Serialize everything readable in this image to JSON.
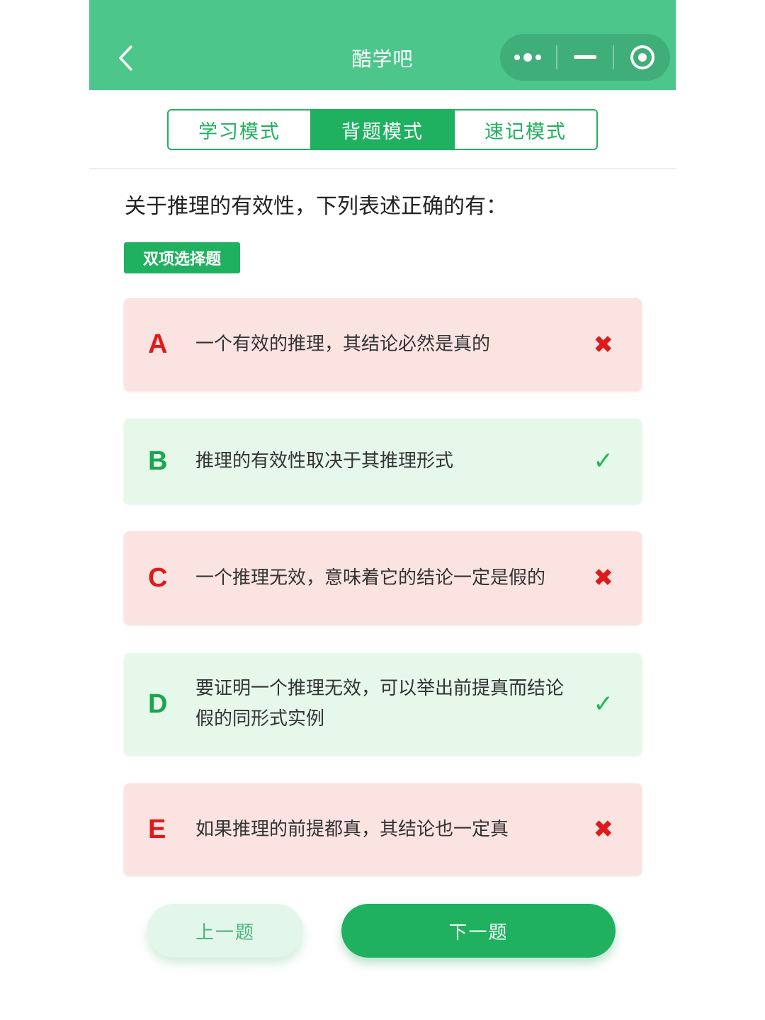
{
  "header": {
    "title": "酷学吧",
    "background_color": "#4cc68b",
    "back_icon": "chevron-left-icon",
    "capsule_icons": [
      "more-dots-icon",
      "minimize-icon",
      "record-target-icon"
    ]
  },
  "tabs": [
    {
      "label": "学习模式",
      "active": false
    },
    {
      "label": "背题模式",
      "active": true
    },
    {
      "label": "速记模式",
      "active": false
    }
  ],
  "question": {
    "text": "关于推理的有效性，下列表述正确的有：",
    "type_badge": "双项选择题"
  },
  "options": [
    {
      "letter": "A",
      "text": "一个有效的推理，其结论必然是真的",
      "status": "wrong",
      "mark": "✖"
    },
    {
      "letter": "B",
      "text": "推理的有效性取决于其推理形式",
      "status": "right",
      "mark": "✓"
    },
    {
      "letter": "C",
      "text": "一个推理无效，意味着它的结论一定是假的",
      "status": "wrong",
      "mark": "✖"
    },
    {
      "letter": "D",
      "text": "要证明一个推理无效，可以举出前提真而结论假的同形式实例",
      "status": "right",
      "mark": "✓"
    },
    {
      "letter": "E",
      "text": "如果推理的前提都真，其结论也一定真",
      "status": "wrong",
      "mark": "✖"
    }
  ],
  "nav": {
    "prev_label": "上一题",
    "next_label": "下一题"
  },
  "colors": {
    "accent": "#1fb15f",
    "wrong": "#e01a1a",
    "wrong_bg": "#fbe3e1",
    "right_bg": "#e6f8ea"
  }
}
